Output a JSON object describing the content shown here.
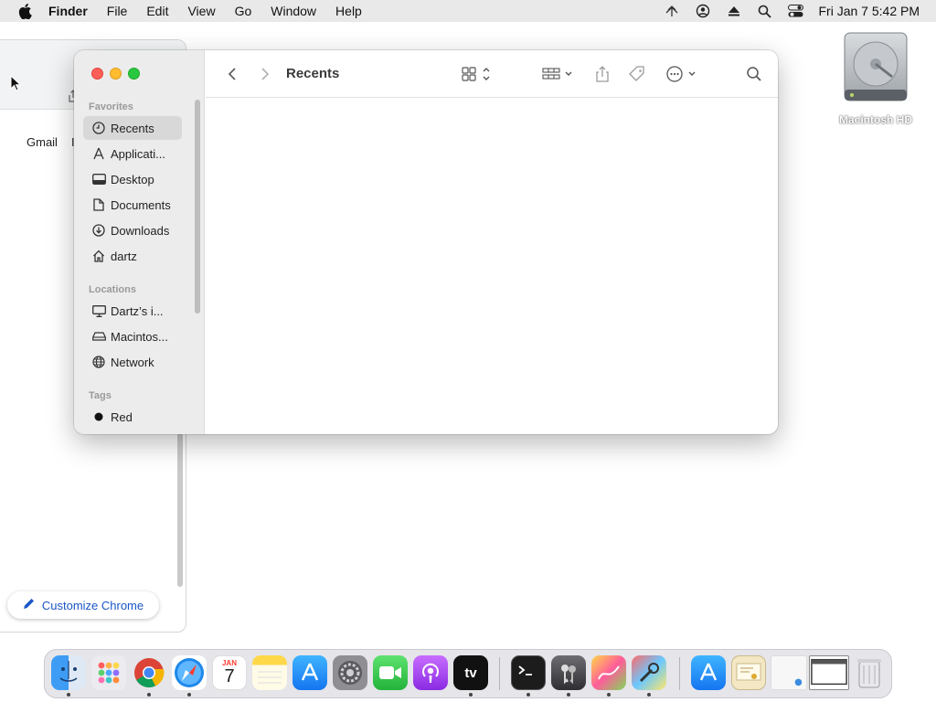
{
  "menubar": {
    "app_name": "Finder",
    "menus": [
      "File",
      "Edit",
      "View",
      "Go",
      "Window",
      "Help"
    ],
    "clock": "Fri Jan 7  5:42 PM",
    "status_icons": [
      "airdrop-icon",
      "user-icon",
      "eject-icon",
      "spotlight-icon",
      "control-center-icon"
    ]
  },
  "chrome_window": {
    "gmail_label": "Gmail",
    "next_label_partial": "I",
    "customize_label": "Customize Chrome"
  },
  "desktop": {
    "hd_label": "Macintosh HD"
  },
  "finder": {
    "title": "Recents",
    "sidebar": {
      "favorites_header": "Favorites",
      "favorites": [
        {
          "label": "Recents",
          "icon": "clock-icon"
        },
        {
          "label": "Applicati...",
          "icon": "applications-icon"
        },
        {
          "label": "Desktop",
          "icon": "desktop-icon"
        },
        {
          "label": "Documents",
          "icon": "document-icon"
        },
        {
          "label": "Downloads",
          "icon": "download-icon"
        },
        {
          "label": "dartz",
          "icon": "home-icon"
        }
      ],
      "locations_header": "Locations",
      "locations": [
        {
          "label": "Dartz’s i...",
          "icon": "computer-icon"
        },
        {
          "label": "Macintos...",
          "icon": "disk-icon"
        },
        {
          "label": "Network",
          "icon": "globe-icon"
        }
      ],
      "tags_header": "Tags",
      "tags": [
        {
          "label": "Red",
          "color": "#111111"
        }
      ]
    }
  },
  "dock": {
    "apps": [
      "Finder",
      "Launchpad",
      "Google Chrome",
      "Safari",
      "Calendar",
      "Notes",
      "App Store",
      "System Preferences",
      "FaceTime",
      "Podcasts",
      "Apple TV",
      "Terminal",
      "Keychain Access",
      "Grapher",
      "Directory Utility",
      "App Store Folder",
      "Certificate Assistant",
      "Preview Window",
      "Window",
      "Trash"
    ],
    "calendar_month": "JAN",
    "calendar_day": "7",
    "tv_label": "tv"
  },
  "colors": {
    "accent": "#1a56c6",
    "traffic_red": "#fe5f57",
    "traffic_yellow": "#febc2e",
    "traffic_green": "#28c840"
  }
}
